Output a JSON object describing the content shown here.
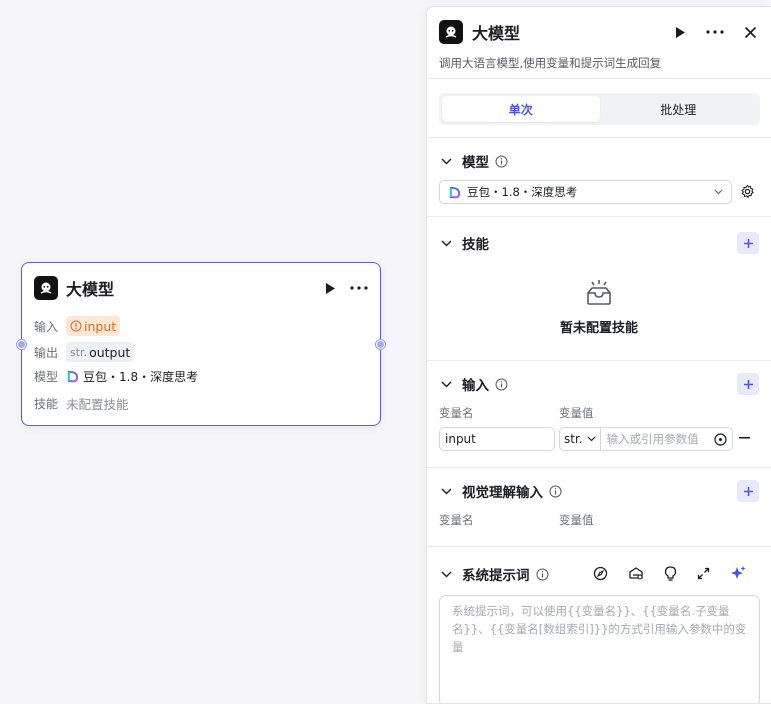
{
  "node": {
    "title": "大模型",
    "input_label": "输入",
    "input_value": "input",
    "output_label": "输出",
    "output_type": "str.",
    "output_value": "output",
    "model_label": "模型",
    "model_value": "豆包・1.8・深度思考",
    "skill_label": "技能",
    "skill_value": "未配置技能"
  },
  "panel": {
    "title": "大模型",
    "description": "调用大语言模型,使用变量和提示词生成回复",
    "tabs": [
      {
        "label": "单次",
        "active": true
      },
      {
        "label": "批处理",
        "active": false
      }
    ],
    "model": {
      "title": "模型",
      "selected": "豆包・1.8・深度思考"
    },
    "skills": {
      "title": "技能",
      "empty_text": "暂未配置技能"
    },
    "inputs": {
      "title": "输入",
      "col_name": "变量名",
      "col_value": "变量值",
      "row": {
        "name": "input",
        "type": "str.",
        "placeholder": "输入或引用参数值"
      }
    },
    "visual": {
      "title": "视觉理解输入",
      "col_name": "变量名",
      "col_value": "变量值"
    },
    "system_prompt": {
      "title": "系统提示词",
      "placeholder": "系统提示词，可以使用{{变量名}}、{{变量名.子变量名}}、{{变量名[数组索引]}}的方式引用输入参数中的变量"
    }
  },
  "colors": {
    "accent": "#4d53e8",
    "node_border": "#5a5be0",
    "input_tag_bg": "#fde7d6",
    "input_tag_text": "#e06a12"
  },
  "icons": [
    "llm-logo-icon",
    "play-icon",
    "more-icon",
    "close-icon",
    "chevron-down-icon",
    "info-icon",
    "plus-icon",
    "gear-icon",
    "box-empty-icon",
    "minus-icon",
    "target-icon",
    "compass-icon",
    "library-icon",
    "bulb-icon",
    "expand-icon",
    "sparkle-icon",
    "doubao-icon",
    "warning-circle-icon"
  ]
}
